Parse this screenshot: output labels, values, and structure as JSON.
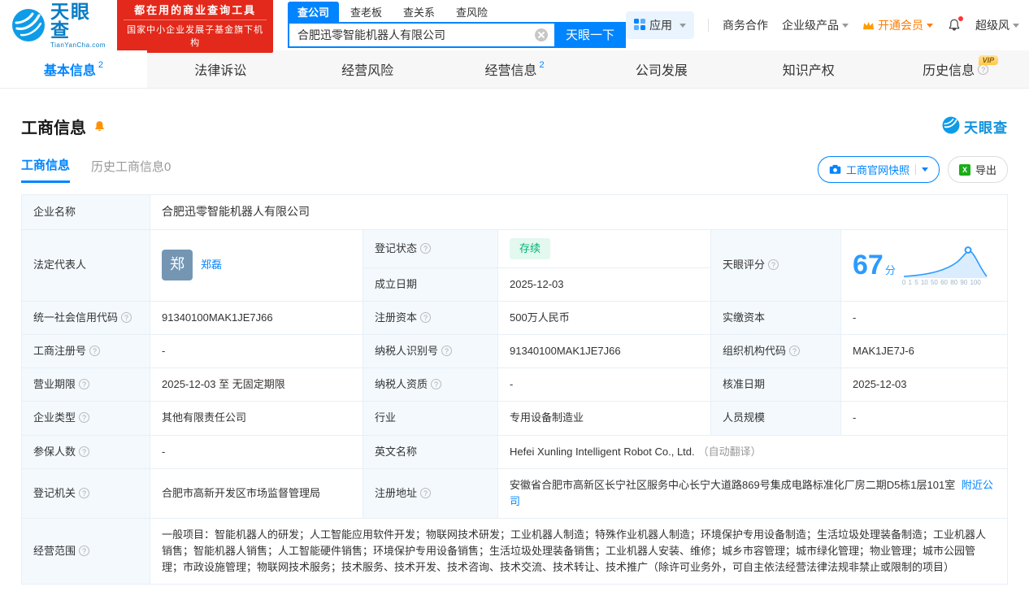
{
  "header": {
    "brand": "天眼查",
    "brand_domain": "TianYanCha.com",
    "slogan1": "都在用的商业查询工具",
    "slogan2": "国家中小企业发展子基金旗下机构",
    "search_tabs": [
      {
        "label": "查公司"
      },
      {
        "label": "查老板"
      },
      {
        "label": "查关系"
      },
      {
        "label": "查风险"
      }
    ],
    "search_value": "合肥迅零智能机器人有限公司",
    "search_btn": "天眼一下",
    "app_menu": "应用",
    "biz_coop": "商务合作",
    "enterprise_product": "企业级产品",
    "vip_join": "开通会员",
    "super_risk": "超级风"
  },
  "nav_tabs": [
    {
      "label": "基本信息",
      "badge": "2"
    },
    {
      "label": "法律诉讼",
      "badge": ""
    },
    {
      "label": "经营风险",
      "badge": ""
    },
    {
      "label": "经营信息",
      "badge": "2"
    },
    {
      "label": "公司发展",
      "badge": ""
    },
    {
      "label": "知识产权",
      "badge": ""
    },
    {
      "label": "历史信息",
      "badge": "",
      "vip": "VIP"
    }
  ],
  "section": {
    "title": "工商信息",
    "watermark": "天眼查",
    "subtab_active": "工商信息",
    "subtab_history": "历史工商信息",
    "subtab_history_count": "0",
    "snapshot_btn": "工商官网快照",
    "export_btn": "导出"
  },
  "fields": {
    "company_name_label": "企业名称",
    "company_name": "合肥迅零智能机器人有限公司",
    "legal_rep_label": "法定代表人",
    "legal_rep_avatar": "郑",
    "legal_rep": "郑磊",
    "reg_status_label": "登记状态",
    "reg_status": "存续",
    "establish_date_label": "成立日期",
    "establish_date": "2025-12-03",
    "score_label": "天眼评分",
    "score": "67",
    "score_unit": "分",
    "credit_code_label": "统一社会信用代码",
    "credit_code": "91340100MAK1JE7J66",
    "reg_capital_label": "注册资本",
    "reg_capital": "500万人民币",
    "paid_capital_label": "实缴资本",
    "paid_capital": "-",
    "reg_no_label": "工商注册号",
    "reg_no": "-",
    "taxpayer_id_label": "纳税人识别号",
    "taxpayer_id": "91340100MAK1JE7J66",
    "org_code_label": "组织机构代码",
    "org_code": "MAK1JE7J-6",
    "term_label": "营业期限",
    "term": "2025-12-03 至 无固定期限",
    "taxpayer_qual_label": "纳税人资质",
    "taxpayer_qual": "-",
    "approval_date_label": "核准日期",
    "approval_date": "2025-12-03",
    "company_type_label": "企业类型",
    "company_type": "其他有限责任公司",
    "industry_label": "行业",
    "industry": "专用设备制造业",
    "staff_label": "人员规模",
    "staff": "-",
    "insured_label": "参保人数",
    "insured": "-",
    "en_name_label": "英文名称",
    "en_name": "Hefei Xunling Intelligent Robot Co., Ltd.",
    "en_name_note": "（自动翻译）",
    "authority_label": "登记机关",
    "authority": "合肥市高新开发区市场监督管理局",
    "address_label": "注册地址",
    "address": "安徽省合肥市高新区长宁社区服务中心长宁大道路869号集成电路标准化厂房二期D5栋1层101室",
    "nearby": "附近公司",
    "scope_label": "经营范围",
    "scope": "一般项目：智能机器人的研发；人工智能应用软件开发；物联网技术研发；工业机器人制造；特殊作业机器人制造；环境保护专用设备制造；生活垃圾处理装备制造；工业机器人销售；智能机器人销售；人工智能硬件销售；环境保护专用设备销售；生活垃圾处理装备销售；工业机器人安装、维修；城乡市容管理；城市绿化管理；物业管理；城市公园管理；市政设施管理；物联网技术服务；技术服务、技术开发、技术咨询、技术交流、技术转让、技术推广（除许可业务外，可自主依法经营法律法规非禁止或限制的项目）"
  },
  "score_axis": "0 1 5 10 50 60 80 90 100",
  "colors": {
    "brand_blue": "#0084ff",
    "promo_red": "#e3291b",
    "status_green": "#00b377",
    "vip_orange": "#ff7d00"
  }
}
